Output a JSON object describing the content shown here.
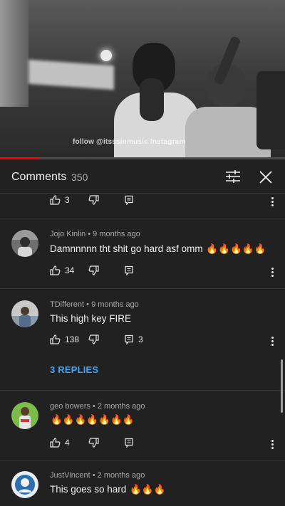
{
  "video": {
    "watermark": "follow @itsssinmusic Instagram",
    "progress_fraction": 0.14
  },
  "header": {
    "title": "Comments",
    "count": "350",
    "filter_icon": "filter-sliders-icon",
    "close_icon": "close-icon"
  },
  "top_actions": {
    "likes": "3"
  },
  "comments": [
    {
      "author": "Jojo Kinlin",
      "time": "9 months ago",
      "text": "Damnnnnn tht shit go hard asf omm",
      "emoji": "🔥🔥🔥🔥🔥",
      "likes": "34",
      "replies_count": ""
    },
    {
      "author": "TDifferent",
      "time": "9 months ago",
      "text": "This high key FIRE",
      "emoji": "",
      "likes": "138",
      "replies_count": "3",
      "replies_link": "3 REPLIES"
    },
    {
      "author": "geo bowers",
      "time": "2 months ago",
      "text": "",
      "emoji": "🔥🔥🔥🔥🔥🔥🔥",
      "likes": "4",
      "replies_count": ""
    },
    {
      "author": "JustVincent",
      "time": "2 months ago",
      "text": "This goes so hard",
      "emoji": "🔥🔥🔥",
      "likes": "",
      "replies_count": ""
    }
  ],
  "separator": "•",
  "colors": {
    "background": "#212121",
    "accent_link": "#3ea6ff",
    "progress": "#ff0000",
    "fire": "#ff6a00"
  }
}
